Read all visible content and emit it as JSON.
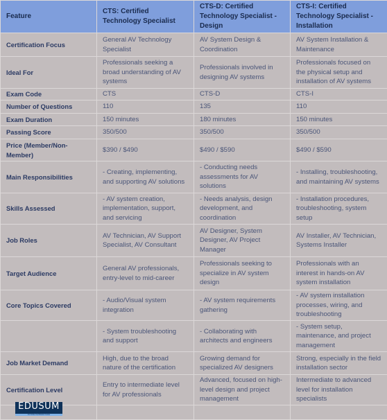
{
  "table": {
    "headers": [
      "Feature",
      "CTS: Certified Technology Specialist",
      "CTS-D: Certified Technology Specialist - Design",
      "CTS-I: Certified Technology Specialist - Installation"
    ],
    "rows": [
      [
        "Certification Focus",
        "General AV Technology Specialist",
        "AV System Design & Coordination",
        "AV System Installation & Maintenance"
      ],
      [
        "Ideal For",
        "Professionals seeking a broad understanding of AV systems",
        "Professionals involved in designing AV systems",
        "Professionals focused on the physical setup and installation of AV systems"
      ],
      [
        "Exam Code",
        "CTS",
        "CTS-D",
        "CTS-I"
      ],
      [
        "Number of Questions",
        "110",
        "135",
        "110"
      ],
      [
        "Exam Duration",
        "150 minutes",
        "180 minutes",
        "150 minutes"
      ],
      [
        "Passing Score",
        "350/500",
        "350/500",
        "350/500"
      ],
      [
        "Price (Member/Non-Member)",
        "$390 / $490",
        "$490 / $590",
        "$490 / $590"
      ],
      [
        "Main Responsibilities",
        "- Creating, implementing, and supporting AV solutions",
        "- Conducting needs assessments for AV solutions",
        "- Installing, troubleshooting, and maintaining AV systems"
      ],
      [
        "Skills Assessed",
        "- AV system creation, implementation, support, and servicing",
        "- Needs analysis, design development, and coordination",
        "- Installation procedures, troubleshooting, system setup"
      ],
      [
        "Job Roles",
        "AV Technician, AV Support Specialist, AV Consultant",
        "AV Designer, System Designer, AV Project Manager",
        "AV Installer, AV Technician, Systems Installer"
      ],
      [
        "Target Audience",
        "General AV professionals, entry-level to mid-career",
        "Professionals seeking to specialize in AV system design",
        "Professionals with an interest in hands-on AV system installation"
      ],
      [
        "Core Topics Covered",
        "- Audio/Visual system integration",
        "- AV system requirements gathering",
        "- AV system installation processes, wiring, and troubleshooting"
      ],
      [
        "",
        "- System troubleshooting and support",
        "- Collaborating with architects and engineers",
        "- System setup, maintenance, and project management"
      ],
      [
        "Job Market Demand",
        "High, due to the broad nature of the certification",
        "Growing demand for specialized AV designers",
        "Strong, especially in the field installation sector"
      ],
      [
        "Certification Level",
        "Entry to intermediate level for AV professionals",
        "Advanced, focused on high-level design and project management",
        "Intermediate to advanced level for installation specialists"
      ],
      [
        "",
        "",
        "",
        ""
      ]
    ]
  },
  "logo": {
    "text": "EDUSUM",
    "tagline": "#1 Online Certification Guide"
  },
  "colors": {
    "header_bg": "#7f9edc",
    "cell_bg": "#c2bcbd",
    "header_text": "#1a2b4e",
    "feature_text": "#2b3a63",
    "cell_text": "#4a5578",
    "logo_bg": "#0f3259"
  }
}
